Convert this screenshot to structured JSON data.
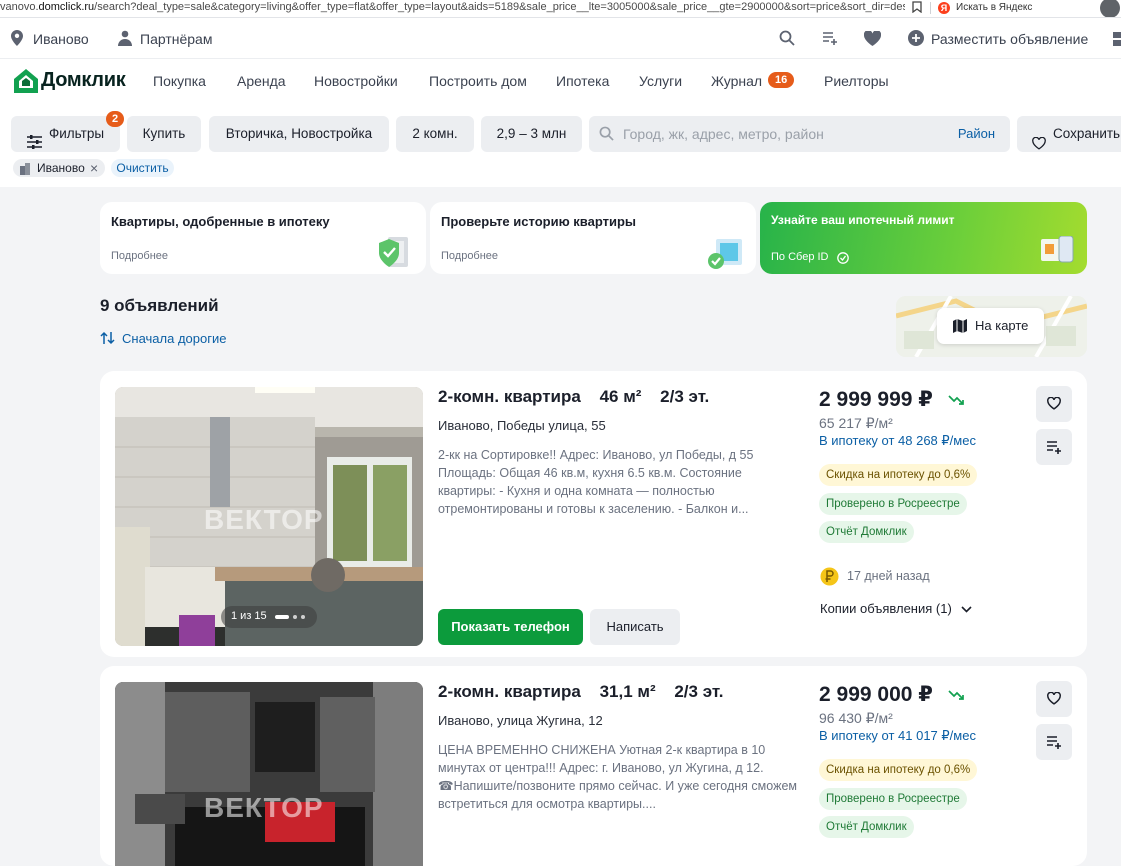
{
  "browser": {
    "url_prefix": "vanovo.",
    "url_host": "domclick.ru",
    "url_path": "/search?deal_type=sale&category=living&offer_type=flat&offer_type=layout&aids=5189&sale_price__lte=3005000&sale_price__gte=2900000&sort=price&sort_dir=desc&room...",
    "yandex_label": "Искать в Яндекс"
  },
  "topnav": {
    "city": "Иваново",
    "partners": "Партнёрам",
    "post_ad": "Разместить объявление"
  },
  "mainnav": {
    "logo": "Домклик",
    "links": [
      "Покупка",
      "Аренда",
      "Новостройки",
      "Построить дом",
      "Ипотека",
      "Услуги",
      "Журнал",
      "Риелторы"
    ],
    "journal_badge": "16"
  },
  "filters": {
    "filters_label": "Фильтры",
    "filters_badge": "2",
    "buy": "Купить",
    "market": "Вторичка, Новостройка",
    "rooms": "2 комн.",
    "price": "2,9 – 3 млн",
    "search_placeholder": "Город, жк, адрес, метро, район",
    "district": "Район",
    "save": "Сохранить",
    "chip_city": "Иваново",
    "clear": "Очистить"
  },
  "promos": [
    {
      "title": "Квартиры, одобренные в ипотеку",
      "sub": "Подробнее"
    },
    {
      "title": "Проверьте историю квартиры",
      "sub": "Подробнее"
    },
    {
      "title": "Узнайте ваш ипотечный лимит",
      "sub": "По Сбер ID"
    }
  ],
  "results": {
    "count": "9 объявлений",
    "sort": "Сначала дорогие",
    "map": "На карте"
  },
  "listings": [
    {
      "title": "2-комн. квартира",
      "area": "46 м²",
      "floor": "2/3 эт.",
      "address": "Иваново, Победы улица, 55",
      "desc": "2-кк на Сортировке!! Адрес: Иваново, ул Победы, д 55 Площадь: Общая 46 кв.м, кухня 6.5 кв.м. Состояние квартиры: - Кухня и одна комната — полностью отремонтированы и готовы к заселению. - Балкон и...",
      "price": "2 999 999 ₽",
      "ppm": "65 217 ₽/м²",
      "mortgage": "В ипотеку от 48 268 ₽/мес",
      "tags": [
        "Скидка на ипотеку до 0,6%",
        "Проверено в Росреестре",
        "Отчёт Домклик"
      ],
      "age": "17 дней назад",
      "copies": "Копии объявления (1)",
      "photo_counter": "1 из 15",
      "watermark": "ВЕКТОР",
      "call": "Показать телефон",
      "write": "Написать"
    },
    {
      "title": "2-комн. квартира",
      "area": "31,1 м²",
      "floor": "2/3 эт.",
      "address": "Иваново, улица Жугина, 12",
      "desc": "ЦЕНА ВРЕМЕННО СНИЖЕНА Уютная 2-к квартира в 10 минутах от центра!!! Адрес: г. Иваново, ул Жугина, д 12. ☎Напишите/позвоните прямо сейчас. И уже сегодня сможем встретиться для осмотра квартиры....",
      "price": "2 999 000 ₽",
      "ppm": "96 430 ₽/м²",
      "mortgage": "В ипотеку от 41 017 ₽/мес",
      "tags": [
        "Скидка на ипотеку до 0,6%",
        "Проверено в Росреестре",
        "Отчёт Домклик"
      ],
      "watermark": "ВЕКТОР"
    }
  ]
}
